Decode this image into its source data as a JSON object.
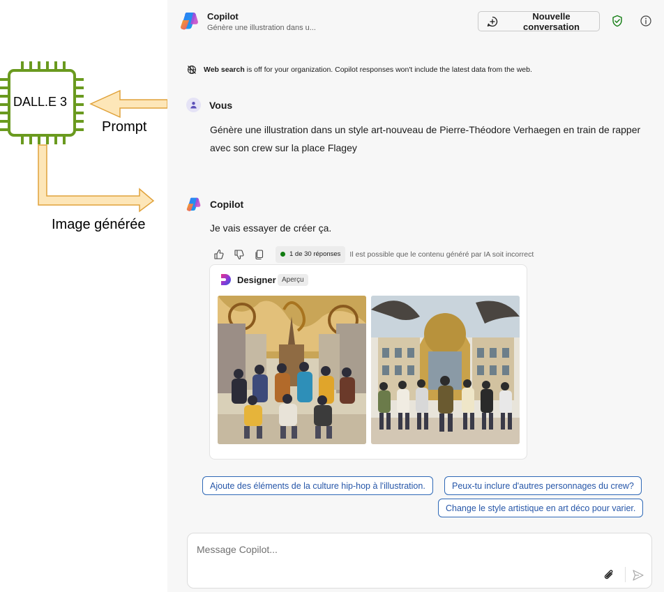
{
  "diagram": {
    "chip_label": "DALL.E 3",
    "prompt_label": "Prompt",
    "image_label": "Image générée",
    "chip_color": "#6a9a1f",
    "arrow_fill": "#fde6b8",
    "arrow_stroke": "#e0a23a"
  },
  "header": {
    "title": "Copilot",
    "subtitle": "Génère une illustration dans u...",
    "new_conversation_label": "Nouvelle conversation",
    "shield_color": "#107c10"
  },
  "web_search": {
    "bold": "Web search",
    "text": " is off for your organization. Copilot responses won't include the latest data from the web."
  },
  "user_message": {
    "author": "Vous",
    "text": "Génère une illustration dans un style art-nouveau de Pierre-Théodore Verhaegen en train de rapper avec son crew sur la place Flagey"
  },
  "bot_message": {
    "author": "Copilot",
    "text": "Je vais essayer de créer ça.",
    "response_count": "1 de 30 réponses",
    "disclaimer": "Il est possible que le contenu généré par IA soit incorrect"
  },
  "designer_card": {
    "title": "Designer",
    "badge": "Aperçu",
    "images": [
      {
        "name": "generated-image-1",
        "alt": "Illustration art nouveau d'un groupe de rappeurs devant une cathédrale"
      },
      {
        "name": "generated-image-2",
        "alt": "Illustration art nouveau d'un crew dansant devant un bâtiment"
      }
    ]
  },
  "suggestions": [
    "Ajoute des éléments de la culture hip-hop à l'illustration.",
    "Peux-tu inclure d'autres personnages du crew?",
    "Change le style artistique en art déco pour varier."
  ],
  "composer": {
    "placeholder": "Message Copilot..."
  },
  "colors": {
    "accent": "#2656a8",
    "panel_bg": "#f7f7f7"
  }
}
